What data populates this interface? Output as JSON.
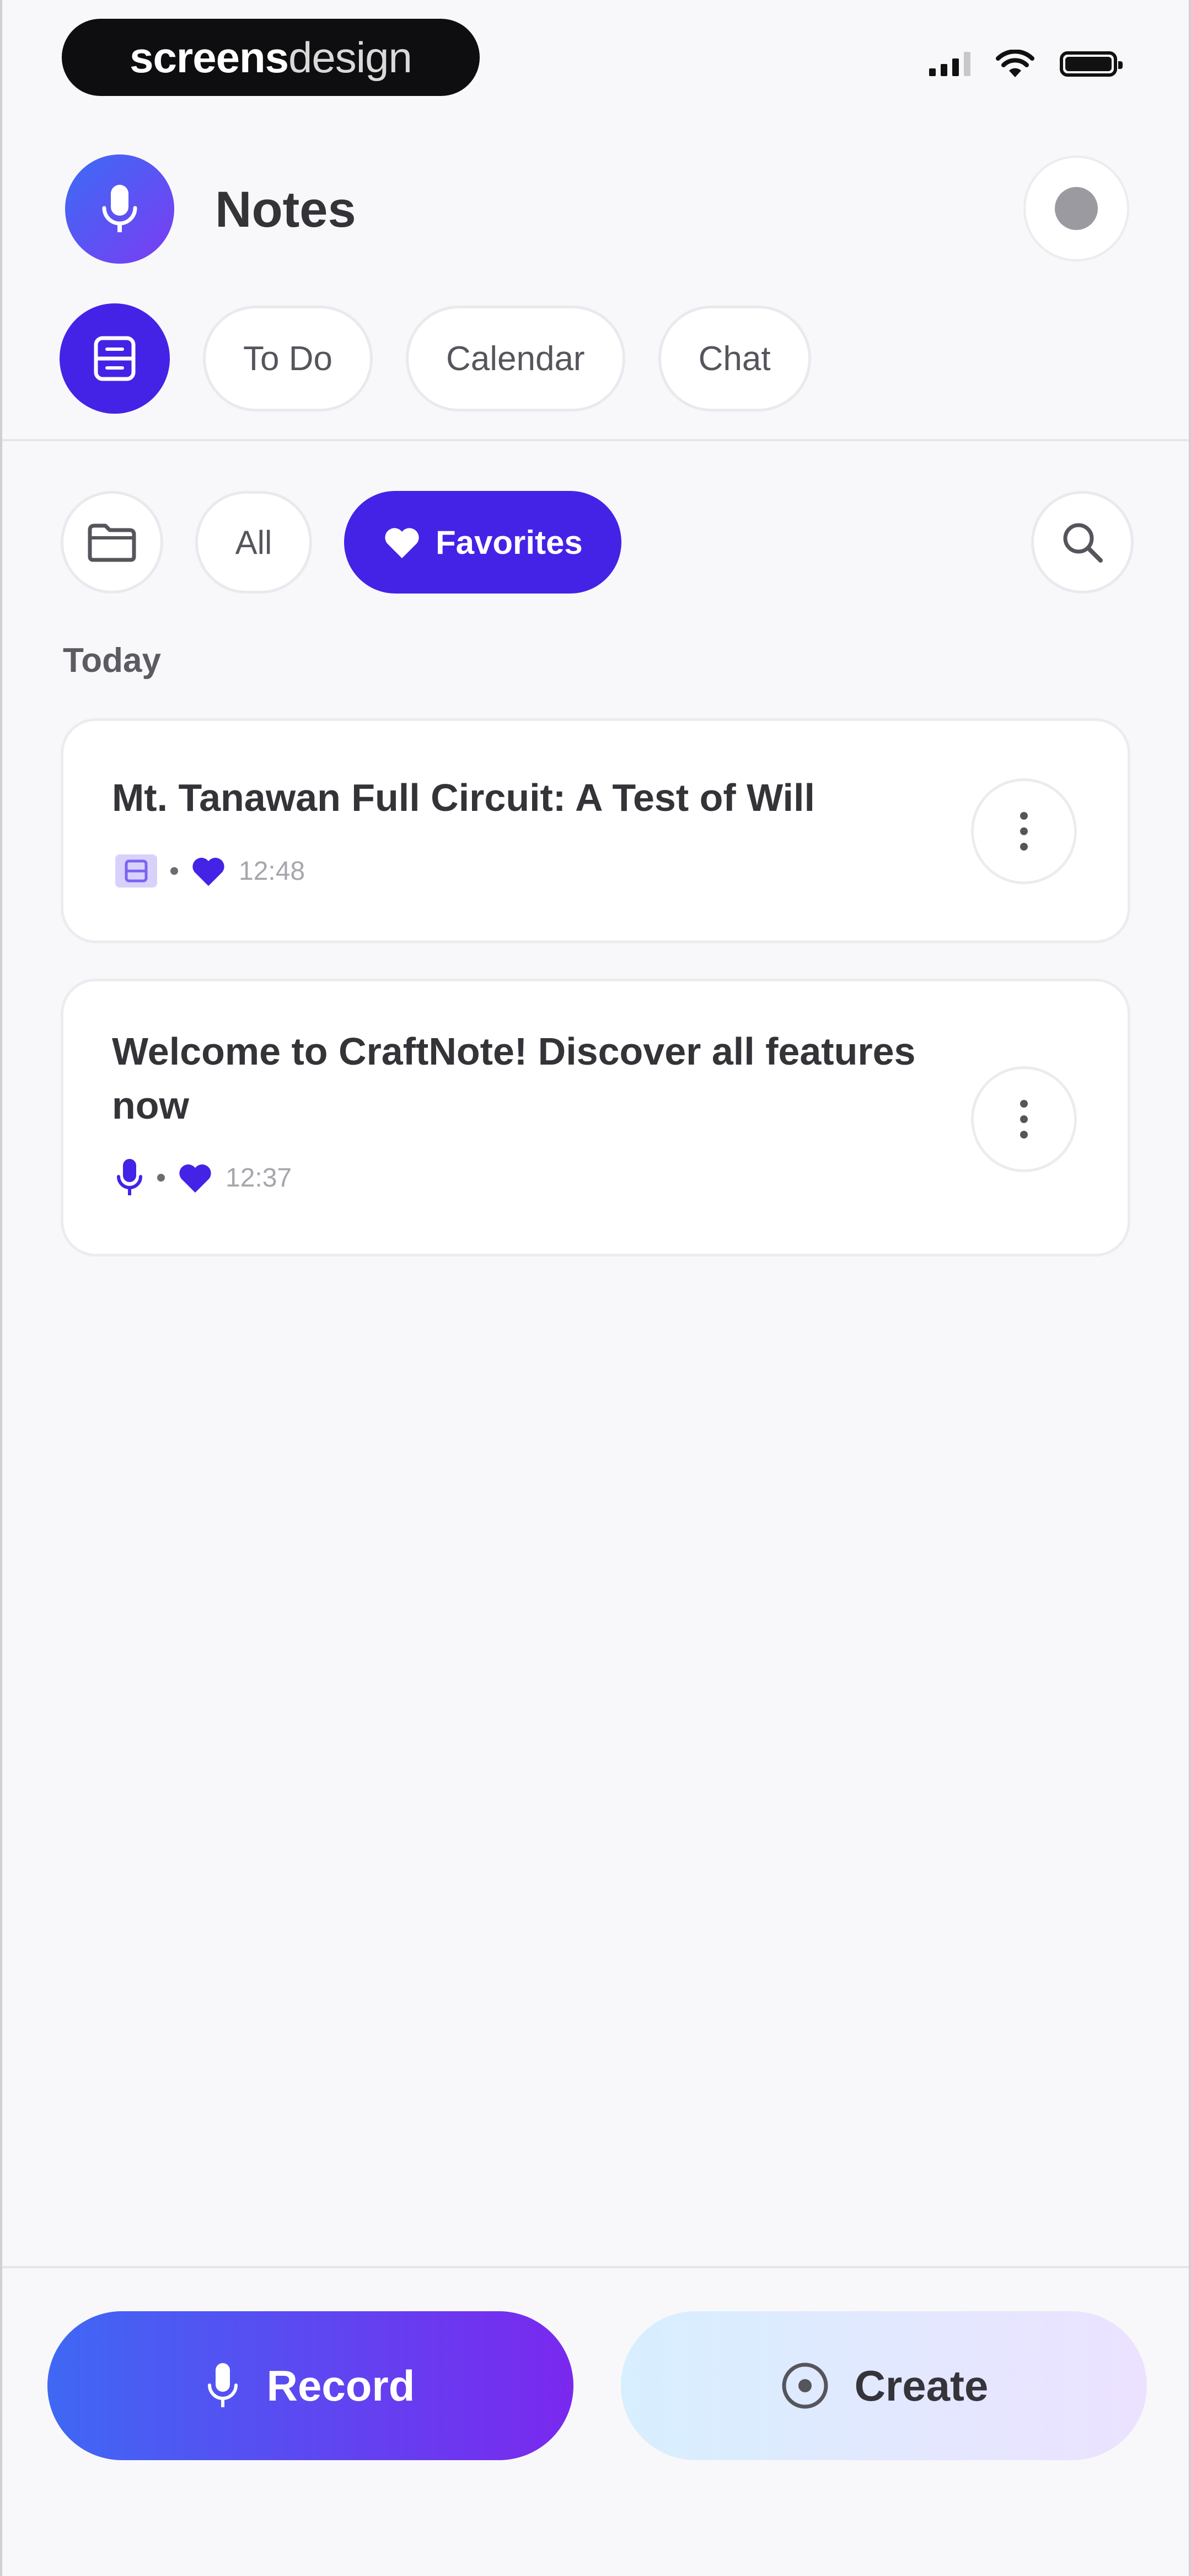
{
  "status_bar": {
    "brand_part1": "screens",
    "brand_part2": "design"
  },
  "header": {
    "title": "Notes",
    "app_icon": "microphone-icon",
    "settings_icon": "settings-icon"
  },
  "nav": {
    "active_icon": "notes-icon",
    "tabs": [
      {
        "label": "To Do"
      },
      {
        "label": "Calendar"
      },
      {
        "label": "Chat"
      }
    ]
  },
  "filters": {
    "folder_icon": "folder-icon",
    "all_label": "All",
    "favorites_label": "Favorites",
    "search_icon": "search-icon"
  },
  "section": {
    "title": "Today"
  },
  "notes": [
    {
      "title": "Mt. Tanawan Full Circuit: A Test of Will",
      "type_icon": "document-icon",
      "favorite": true,
      "time": "12:48"
    },
    {
      "title": "Welcome to CraftNote! Discover all features now",
      "type_icon": "microphone-icon",
      "favorite": true,
      "time": "12:37"
    }
  ],
  "actions": {
    "record_label": "Record",
    "create_label": "Create"
  },
  "colors": {
    "accent": "#4423e6",
    "record_gradient_start": "#3f68f4",
    "record_gradient_end": "#7a28ee",
    "create_gradient_start": "#d7efff",
    "create_gradient_end": "#ece2ff",
    "background": "#f8f8fa"
  }
}
